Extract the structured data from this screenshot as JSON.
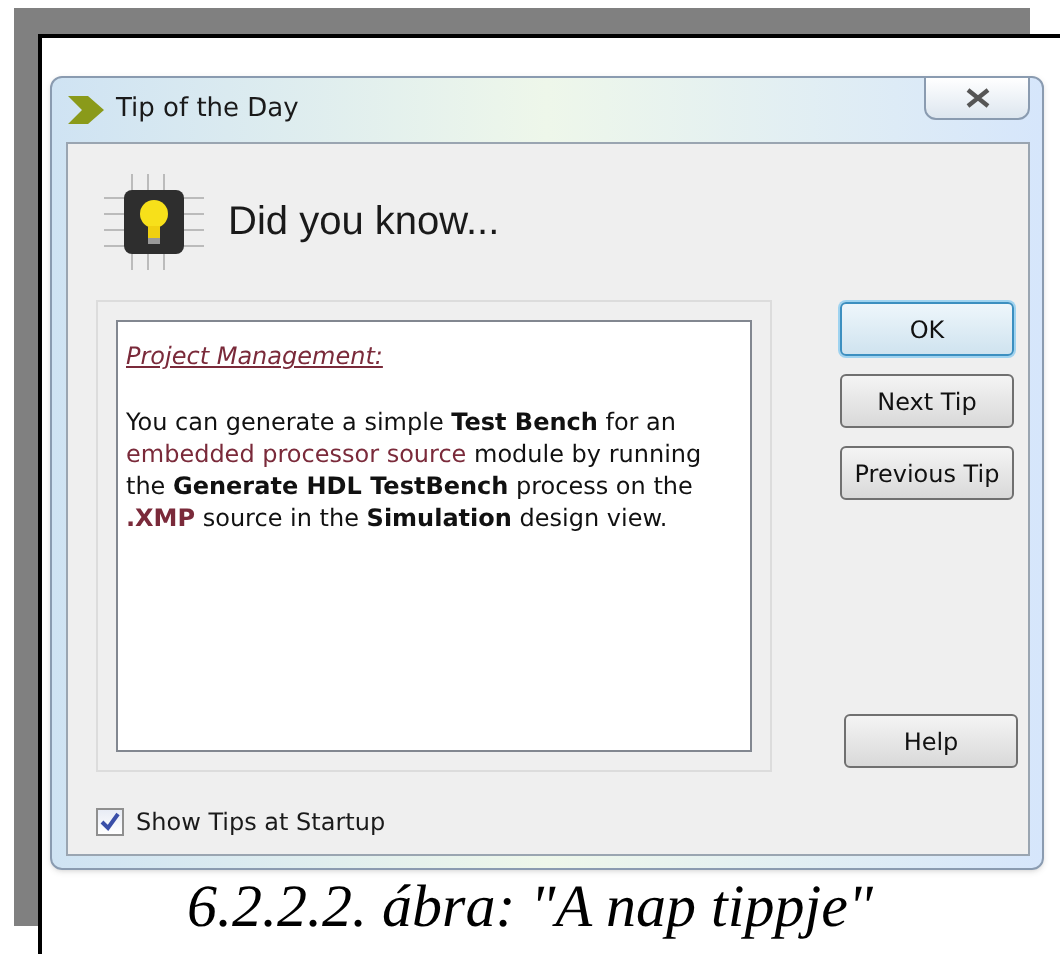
{
  "window": {
    "title": "Tip of the Day"
  },
  "heading": "Did you know...",
  "tip": {
    "category": "Project Management:",
    "body": [
      {
        "kind": "text",
        "text": "You can generate a simple "
      },
      {
        "kind": "bold",
        "text": "Test Bench"
      },
      {
        "kind": "text",
        "text": " for an "
      },
      {
        "kind": "link",
        "text": "embedded processor source"
      },
      {
        "kind": "text",
        "text": " module by running the "
      },
      {
        "kind": "bold",
        "text": "Generate HDL TestBench"
      },
      {
        "kind": "text",
        "text": " process on the "
      },
      {
        "kind": "bold_accent",
        "text": ".XMP"
      },
      {
        "kind": "text",
        "text": " source in the "
      },
      {
        "kind": "bold",
        "text": "Simulation"
      },
      {
        "kind": "text",
        "text": " design view."
      }
    ]
  },
  "buttons": [
    {
      "label": "OK",
      "default": true
    },
    {
      "label": "Next Tip",
      "default": false
    },
    {
      "label": "Previous Tip",
      "default": false
    }
  ],
  "help_button": {
    "label": "Help"
  },
  "show_tips": {
    "label": "Show Tips at Startup",
    "checked": true
  },
  "caption": "6.2.2.2. ábra: \"A nap tippje\""
}
